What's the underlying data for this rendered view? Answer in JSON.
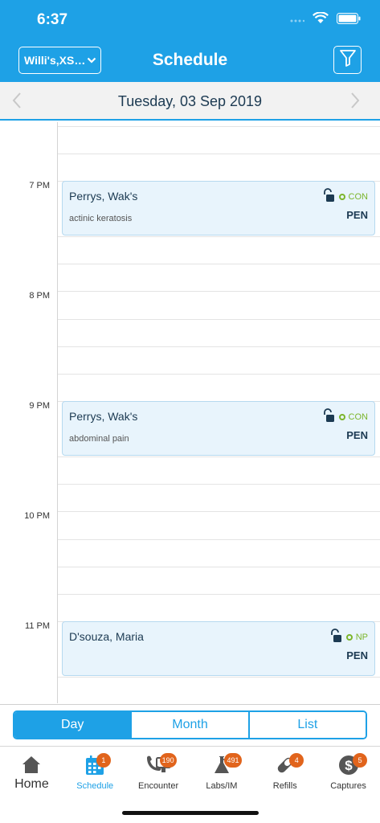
{
  "status_bar": {
    "time": "6:37"
  },
  "header": {
    "provider": "Willi's,XSa...",
    "title": "Schedule"
  },
  "date_bar": {
    "date": "Tuesday, 03 Sep 2019"
  },
  "timeline": {
    "hours": [
      "7 PM",
      "8 PM",
      "9 PM",
      "10 PM",
      "11 PM"
    ],
    "appointments": [
      {
        "name": "Perrys, Wak's",
        "reason": "actinic keratosis",
        "status": "CON",
        "state": "PEN"
      },
      {
        "name": "Perrys, Wak's",
        "reason": "abdominal pain",
        "status": "CON",
        "state": "PEN"
      },
      {
        "name": "D'souza, Maria",
        "reason": "",
        "status": "NP",
        "state": "PEN"
      }
    ]
  },
  "view_switch": {
    "day": "Day",
    "month": "Month",
    "list": "List",
    "selected": "Day"
  },
  "tabbar": {
    "tabs": [
      {
        "label": "Home",
        "badge": ""
      },
      {
        "label": "Schedule",
        "badge": "1"
      },
      {
        "label": "Encounter",
        "badge": "190"
      },
      {
        "label": "Labs/IM",
        "badge": "491"
      },
      {
        "label": "Refills",
        "badge": "4"
      },
      {
        "label": "Captures",
        "badge": "5"
      }
    ]
  },
  "colors": {
    "primary": "#1ea1e6",
    "badge": "#e1641c",
    "status_green": "#7cb52b",
    "appt_bg": "#e8f4fc"
  }
}
